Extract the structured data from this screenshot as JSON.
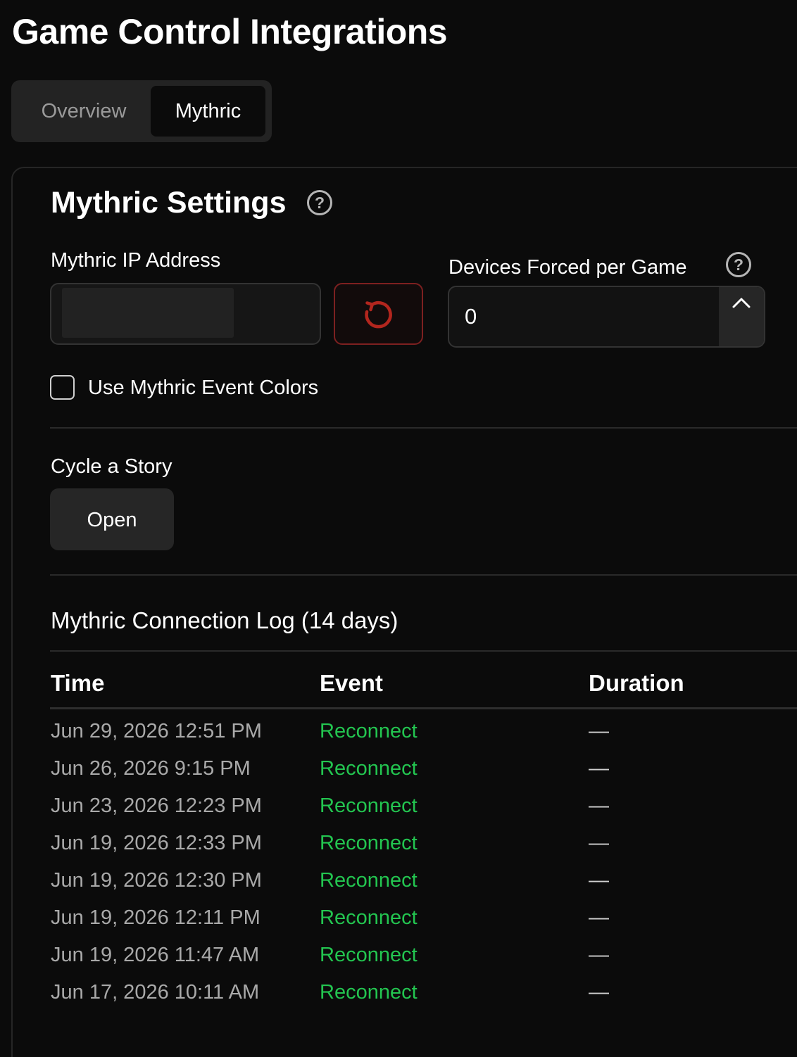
{
  "page": {
    "title": "Game Control Integrations"
  },
  "tabs": [
    {
      "label": "Overview",
      "active": false
    },
    {
      "label": "Mythric",
      "active": true
    }
  ],
  "settings": {
    "title": "Mythric Settings",
    "ip_label": "Mythric IP Address",
    "ip_value": "",
    "devices_label": "Devices Forced per Game",
    "devices_value": "0",
    "use_colors_label": "Use Mythric Event Colors",
    "use_colors_checked": false,
    "cycle_label": "Cycle a Story",
    "open_label": "Open"
  },
  "log": {
    "title": "Mythric Connection Log (14 days)",
    "columns": [
      "Time",
      "Event",
      "Duration"
    ],
    "rows": [
      {
        "time": "Jun 29, 2026 12:51 PM",
        "event": "Reconnect",
        "duration": "—"
      },
      {
        "time": "Jun 26, 2026 9:15 PM",
        "event": "Reconnect",
        "duration": "—"
      },
      {
        "time": "Jun 23, 2026 12:23 PM",
        "event": "Reconnect",
        "duration": "—"
      },
      {
        "time": "Jun 19, 2026 12:33 PM",
        "event": "Reconnect",
        "duration": "—"
      },
      {
        "time": "Jun 19, 2026 12:30 PM",
        "event": "Reconnect",
        "duration": "—"
      },
      {
        "time": "Jun 19, 2026 12:11 PM",
        "event": "Reconnect",
        "duration": "—"
      },
      {
        "time": "Jun 19, 2026 11:47 AM",
        "event": "Reconnect",
        "duration": "—"
      },
      {
        "time": "Jun 17, 2026 10:11 AM",
        "event": "Reconnect",
        "duration": "—"
      }
    ]
  },
  "icons": {
    "help": "question-circle-icon",
    "reset": "refresh-icon",
    "stepper": "chevron-up-icon"
  },
  "colors": {
    "background": "#0b0b0b",
    "event_green": "#23c550",
    "reset_border": "#7d2020",
    "reset_icon": "#b3261e"
  }
}
